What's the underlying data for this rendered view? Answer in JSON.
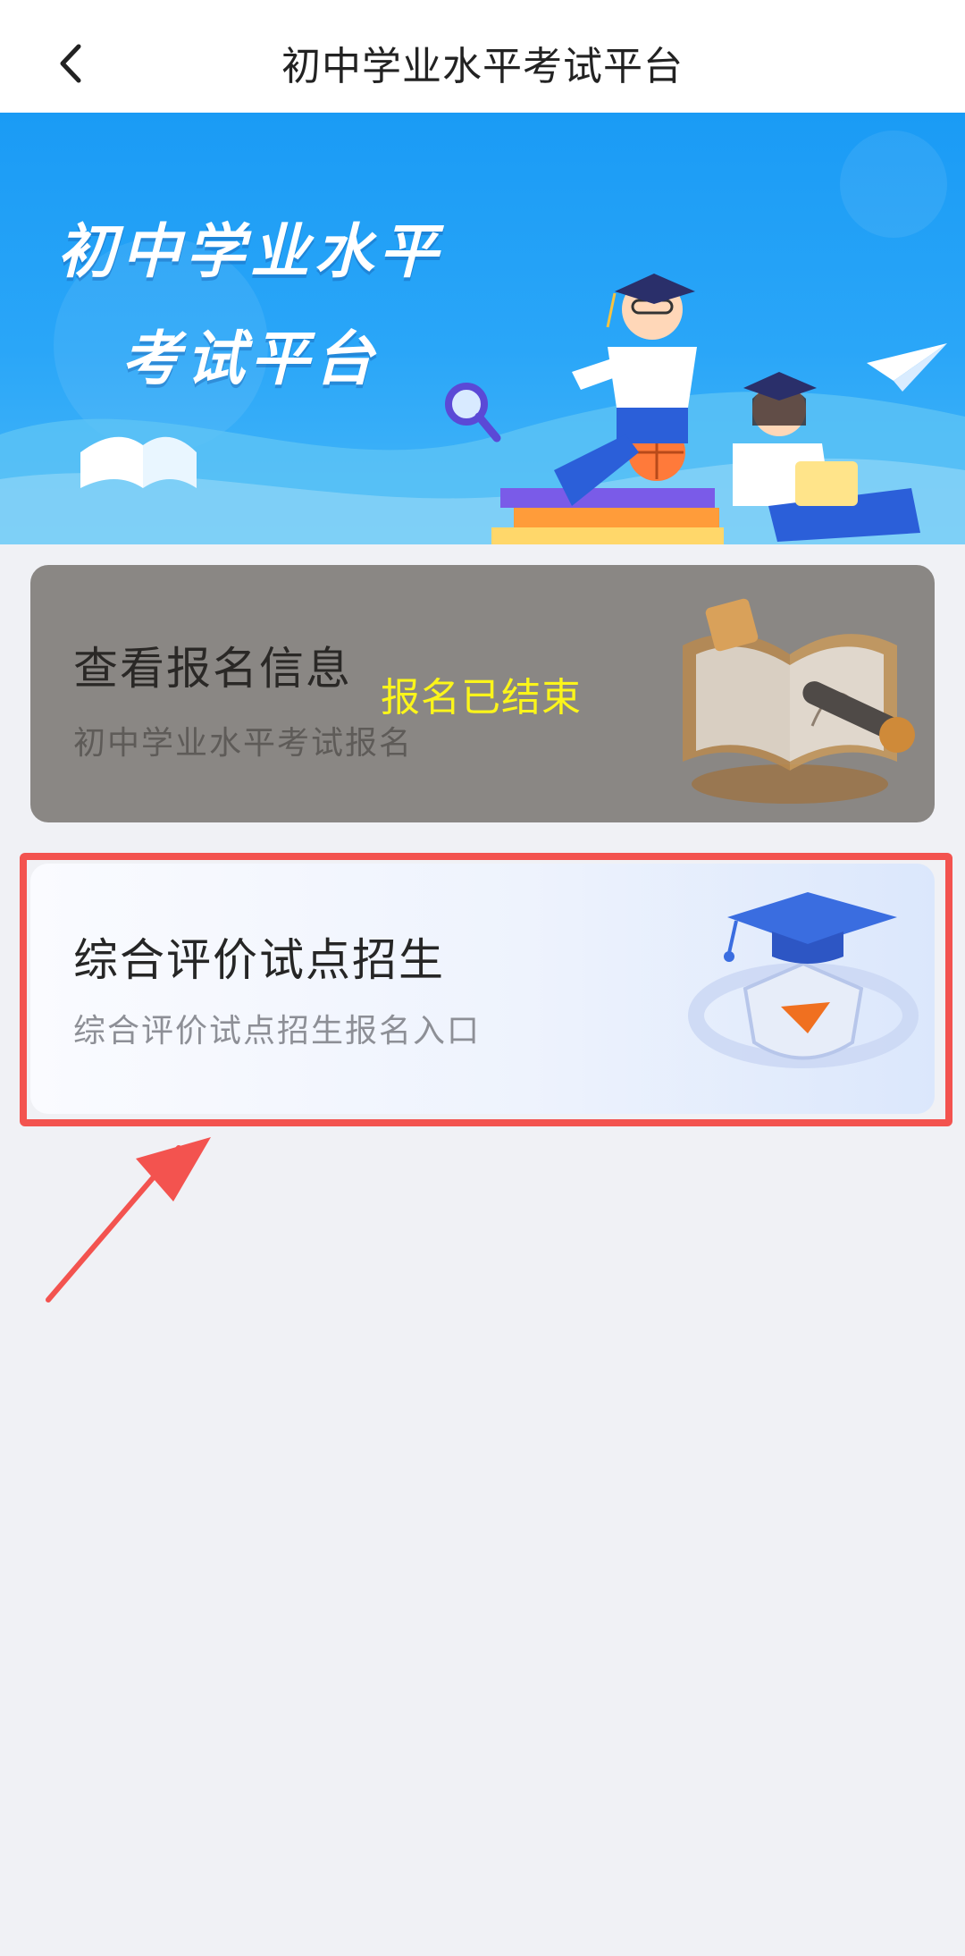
{
  "header": {
    "title": "初中学业水平考试平台",
    "back_icon": "chevron-left-icon"
  },
  "banner": {
    "title_line1": "初中学业水平",
    "title_line2": "考试平台"
  },
  "cards": [
    {
      "title": "查看报名信息",
      "subtitle": "初中学业水平考试报名",
      "overlay_status": "报名已结束",
      "icon": "book-icon"
    },
    {
      "title": "综合评价试点招生",
      "subtitle": "综合评价试点招生报名入口",
      "icon": "graduation-cap-icon"
    }
  ],
  "annotation": {
    "highlight_color": "#f3534f"
  }
}
